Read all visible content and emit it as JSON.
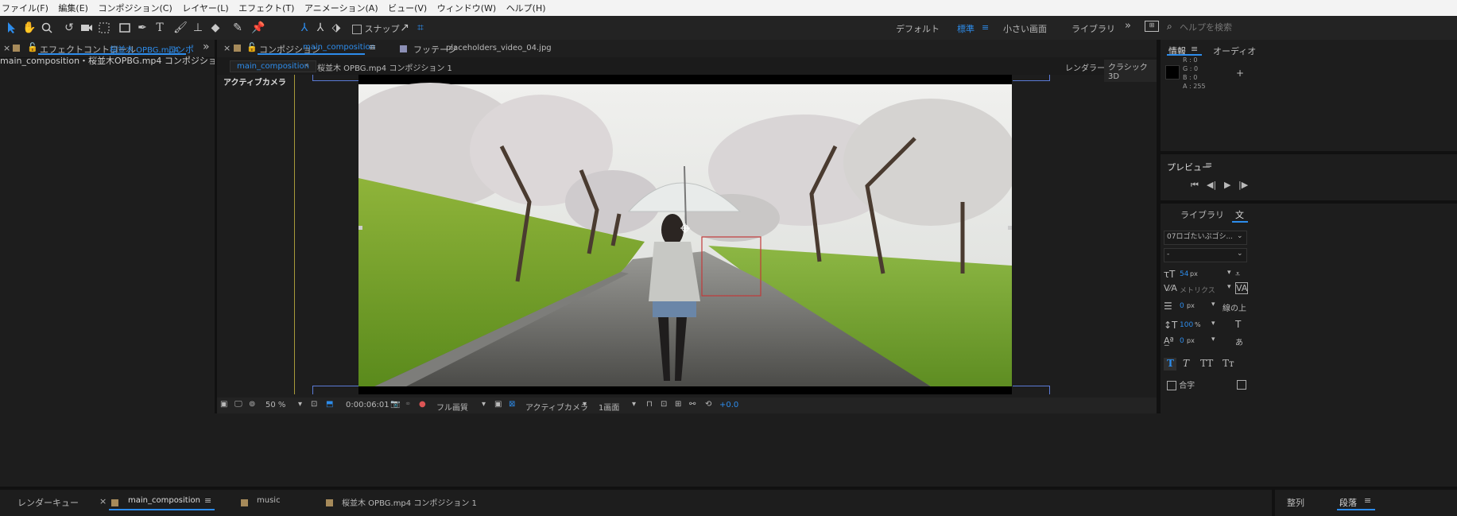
{
  "menu": [
    "ファイル(F)",
    "編集(E)",
    "コンポジション(C)",
    "レイヤー(L)",
    "エフェクト(T)",
    "アニメーション(A)",
    "ビュー(V)",
    "ウィンドウ(W)",
    "ヘルプ(H)"
  ],
  "toolbar": {
    "snap_label": "スナップ",
    "workspaces": [
      "デフォルト",
      "標準",
      "小さい画面",
      "ライブラリ"
    ],
    "search_placeholder": "ヘルプを検索"
  },
  "effects_panel": {
    "tab_prefix": "エフェクトコントロール",
    "tab_file": "桜並木 OPBG.mp4",
    "tab_suffix": "コンポ",
    "subtitle": "main_composition・桜並木OPBG.mp4 コンポジション 1"
  },
  "comp_panel": {
    "tab_prefix": "コンポジション",
    "tab_name": "main_composition",
    "footage_prefix": "フッテージ",
    "footage_name": "placeholders_video_04.jpg",
    "breadcrumb_active": "main_composition",
    "breadcrumb_next": "桜並木 OPBG.mp4 コンポジション 1",
    "renderer_label": "レンダラー :",
    "renderer_value": "クラシック3D",
    "camera_label": "アクティブカメラ"
  },
  "viewer_bar": {
    "zoom": "50 %",
    "timecode": "0:00:06:01",
    "quality": "フル画質",
    "camera": "アクティブカメラ",
    "views": "1画面",
    "exposure": "+0.0"
  },
  "info_panel": {
    "tab": "情報",
    "tab2": "オーディオ",
    "r_label": "R :",
    "r": "0",
    "g_label": "G :",
    "g": "0",
    "b_label": "B :",
    "b": "0",
    "a_label": "A :",
    "a": "255"
  },
  "preview_panel": {
    "title": "プレビュー"
  },
  "char_panel": {
    "tab1": "ライブラリ",
    "tab2": "文",
    "font": "07ロゴたいぷゴシ...",
    "style": "-",
    "size": "54",
    "size_unit": "px",
    "kerning": "メトリクス",
    "stroke": "0",
    "stroke_unit": "px",
    "stroke_opt": "線の上",
    "vscale": "100",
    "vscale_unit": "%",
    "baseline": "0",
    "baseline_unit": "px",
    "styles": [
      "T",
      "T",
      "TT",
      "Tт"
    ],
    "ligature": "合字"
  },
  "bottom_tabs": {
    "render_queue": "レンダーキュー",
    "main": "main_composition",
    "music": "music",
    "comp1": "桜並木 OPBG.mp4 コンポジション 1",
    "align": "整列",
    "paragraph": "段落"
  },
  "colors": {
    "accent": "#2d8ceb",
    "bg": "#1d1d1d",
    "guide": "#5b7bd6",
    "selection": "#c23a3a"
  }
}
